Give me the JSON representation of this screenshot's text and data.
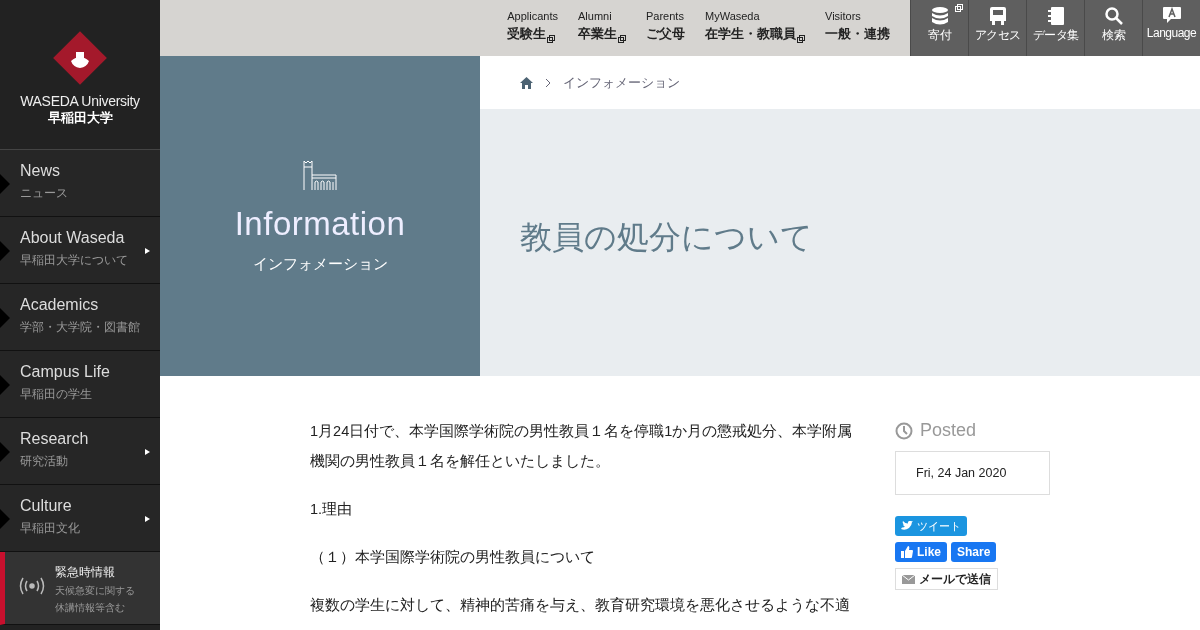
{
  "logo": {
    "name": "WASEDA University",
    "name_ja": "早稲田大学"
  },
  "sidebar": {
    "items": [
      {
        "title": "News",
        "subtitle": "ニュース",
        "has_submenu": false
      },
      {
        "title": "About Waseda",
        "subtitle": "早稲田大学について",
        "has_submenu": true
      },
      {
        "title": "Academics",
        "subtitle": "学部・大学院・図書館",
        "has_submenu": false
      },
      {
        "title": "Campus Life",
        "subtitle": "早稲田の学生",
        "has_submenu": false
      },
      {
        "title": "Research",
        "subtitle": "研究活動",
        "has_submenu": true
      },
      {
        "title": "Culture",
        "subtitle": "早稲田文化",
        "has_submenu": true
      }
    ],
    "emergency": {
      "title": "緊急時情報",
      "lines": [
        "天候急変に関する",
        "休講情報等含む"
      ]
    }
  },
  "top_links": [
    {
      "label": "Applicants",
      "title": "受験生",
      "external": true
    },
    {
      "label": "Alumni",
      "title": "卒業生",
      "external": true
    },
    {
      "label": "Parents",
      "title": "ご父母",
      "external": false
    },
    {
      "label": "MyWaseda",
      "title": "在学生・教職員",
      "external": true
    },
    {
      "label": "Visitors",
      "title": "一般・連携",
      "external": false
    }
  ],
  "top_icons": [
    {
      "kind": "donate",
      "label": "寄付",
      "external": true
    },
    {
      "kind": "access",
      "label": "アクセス",
      "external": false
    },
    {
      "kind": "data",
      "label": "データ集",
      "external": false
    },
    {
      "kind": "search",
      "label": "検索",
      "external": false
    },
    {
      "kind": "language",
      "label": "Language",
      "external": false
    }
  ],
  "hero": {
    "title": "Information",
    "subtitle": "インフォメーション"
  },
  "breadcrumb": [
    "インフォメーション"
  ],
  "page_title": "教員の処分について",
  "article": {
    "paragraphs": [
      {
        "kind": "text",
        "text": "1月24日付で、本学国際学術院の男性教員１名を停職1か月の懲戒処分、本学附属機関の男性教員１名を解任といたしました。"
      },
      {
        "kind": "text",
        "text": "1.理由"
      },
      {
        "kind": "text",
        "text": "（１）本学国際学術院の男性教員について"
      },
      {
        "kind": "text",
        "text": "複数の学生に対して、精神的苦痛を与え、教育研究環境を悪化させるような不適"
      }
    ]
  },
  "posted": {
    "heading": "Posted",
    "date": "Fri, 24 Jan 2020"
  },
  "share": {
    "tweet": "ツイート",
    "like": "Like",
    "share": "Share",
    "mail": "メールで送信"
  }
}
